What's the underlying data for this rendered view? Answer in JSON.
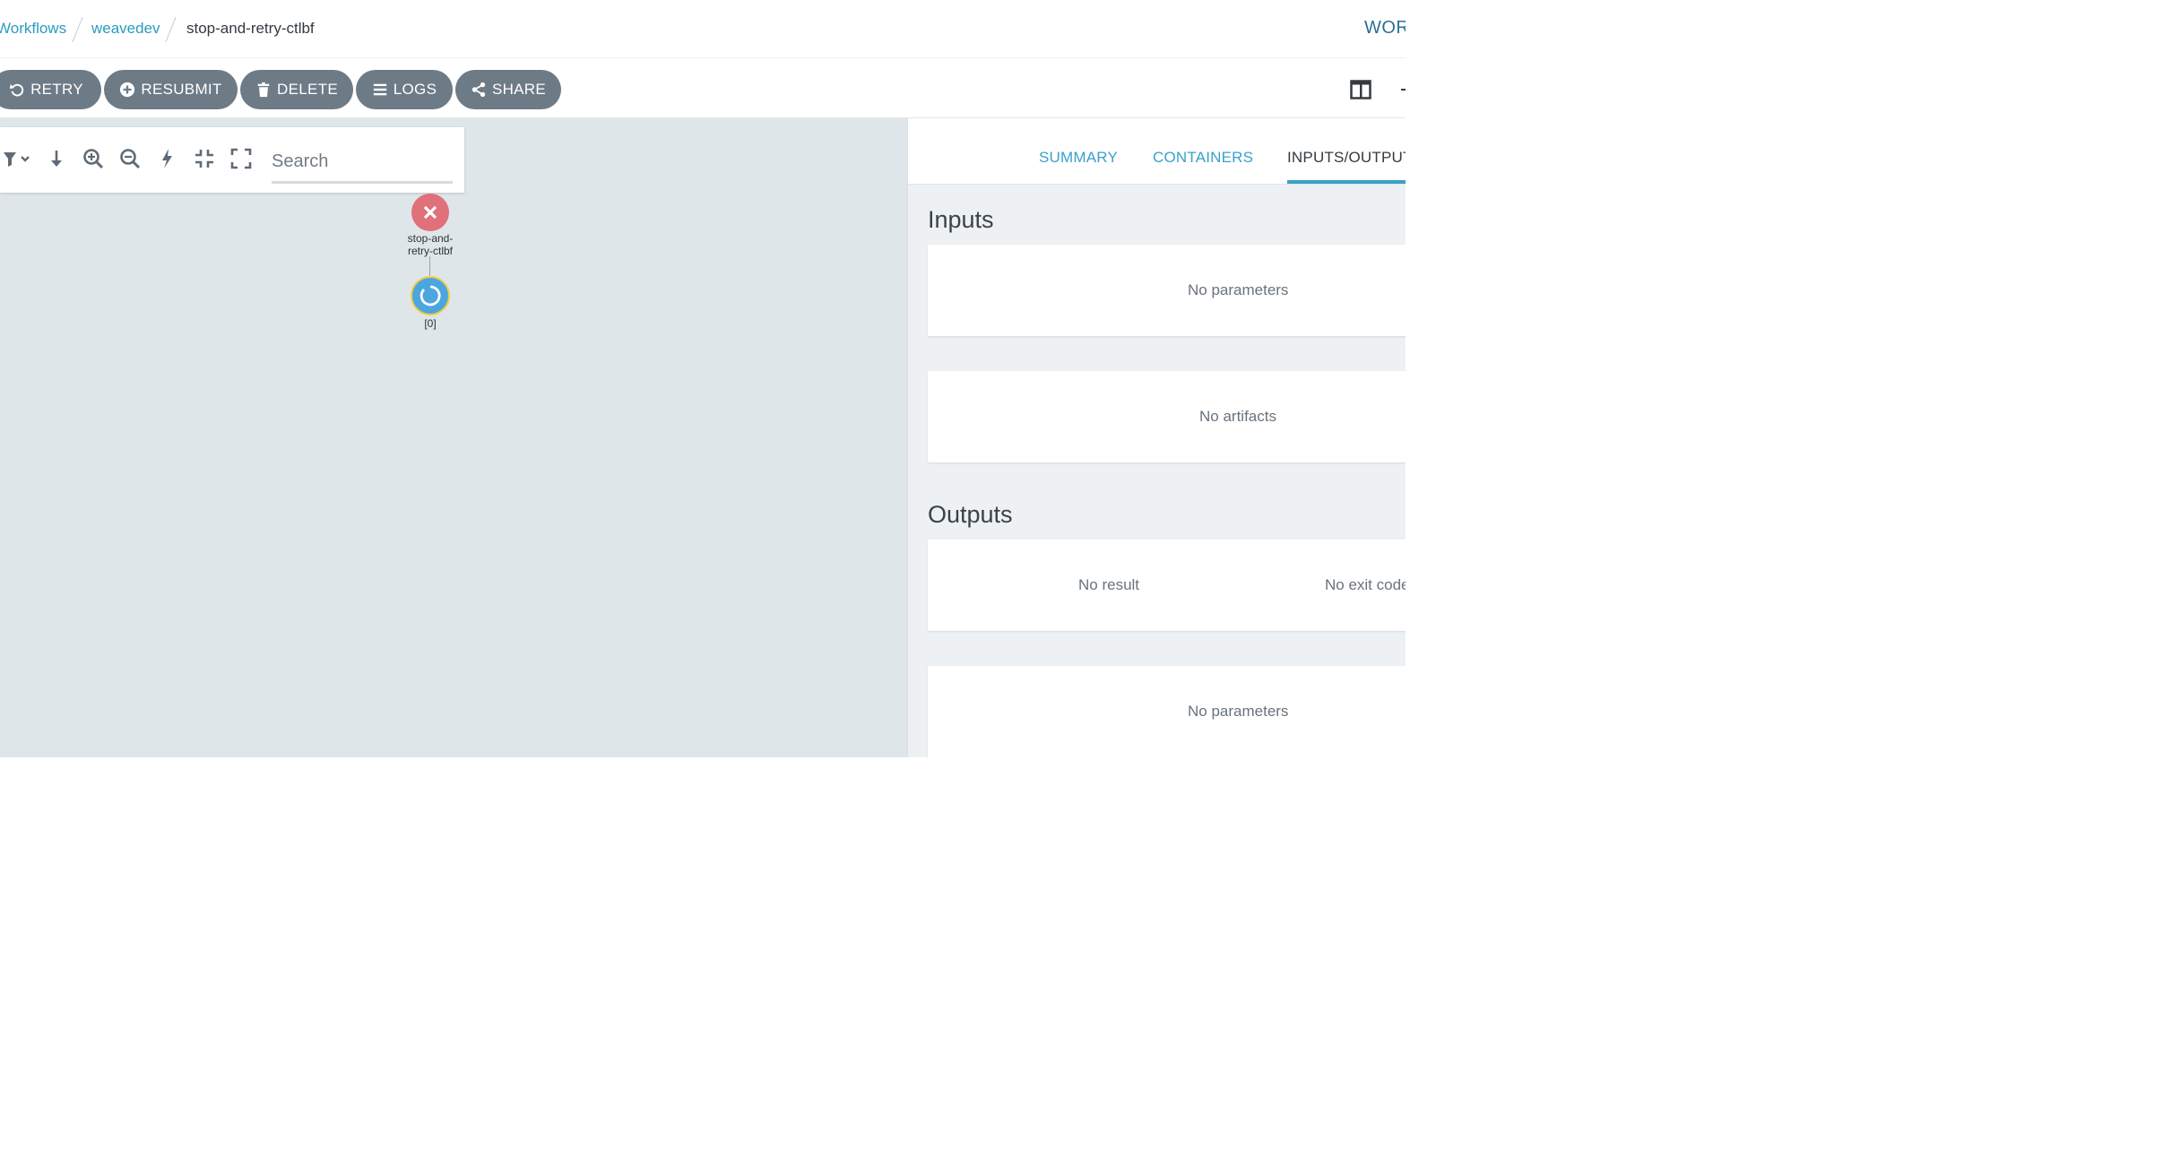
{
  "breadcrumb": {
    "workflows": "Workflows",
    "namespace": "weavedev",
    "current": "stop-and-retry-ctlbf"
  },
  "brand": "WORKFLOW DETAILS",
  "actions": {
    "retry": "RETRY",
    "resubmit": "RESUBMIT",
    "delete": "DELETE",
    "logs": "LOGS",
    "share": "SHARE"
  },
  "graph": {
    "search_placeholder": "Search",
    "nodes": {
      "root": {
        "label": "stop-and-retry-ctlbf",
        "label_line1": "stop-and-",
        "label_line2": "retry-ctlbf",
        "status": "failed"
      },
      "child": {
        "label": "[0]",
        "status": "running"
      }
    }
  },
  "panel": {
    "tabs": [
      "SUMMARY",
      "CONTAINERS",
      "INPUTS/OUTPUTS"
    ],
    "active_tab": "INPUTS/OUTPUTS",
    "inputs_title": "Inputs",
    "inputs_parameters": "No parameters",
    "inputs_artifacts": "No artifacts",
    "outputs_title": "Outputs",
    "outputs_result": "No result",
    "outputs_exit_code": "No exit code",
    "outputs_parameters": "No parameters"
  },
  "icons": {
    "retry": "undo-icon",
    "resubmit": "plus-circle-icon",
    "delete": "trash-icon",
    "logs": "bars-icon",
    "share": "share-icon",
    "layout": "split-columns-icon"
  },
  "colors": {
    "link": "#2b9bbf",
    "button": "#6d7b87",
    "graph_bg": "#dfe6ea",
    "failed": "#e0707a",
    "running": "#4ba6e0",
    "running_ring": "#f2cf3d",
    "tab_active_underline": "#39a1c8"
  }
}
